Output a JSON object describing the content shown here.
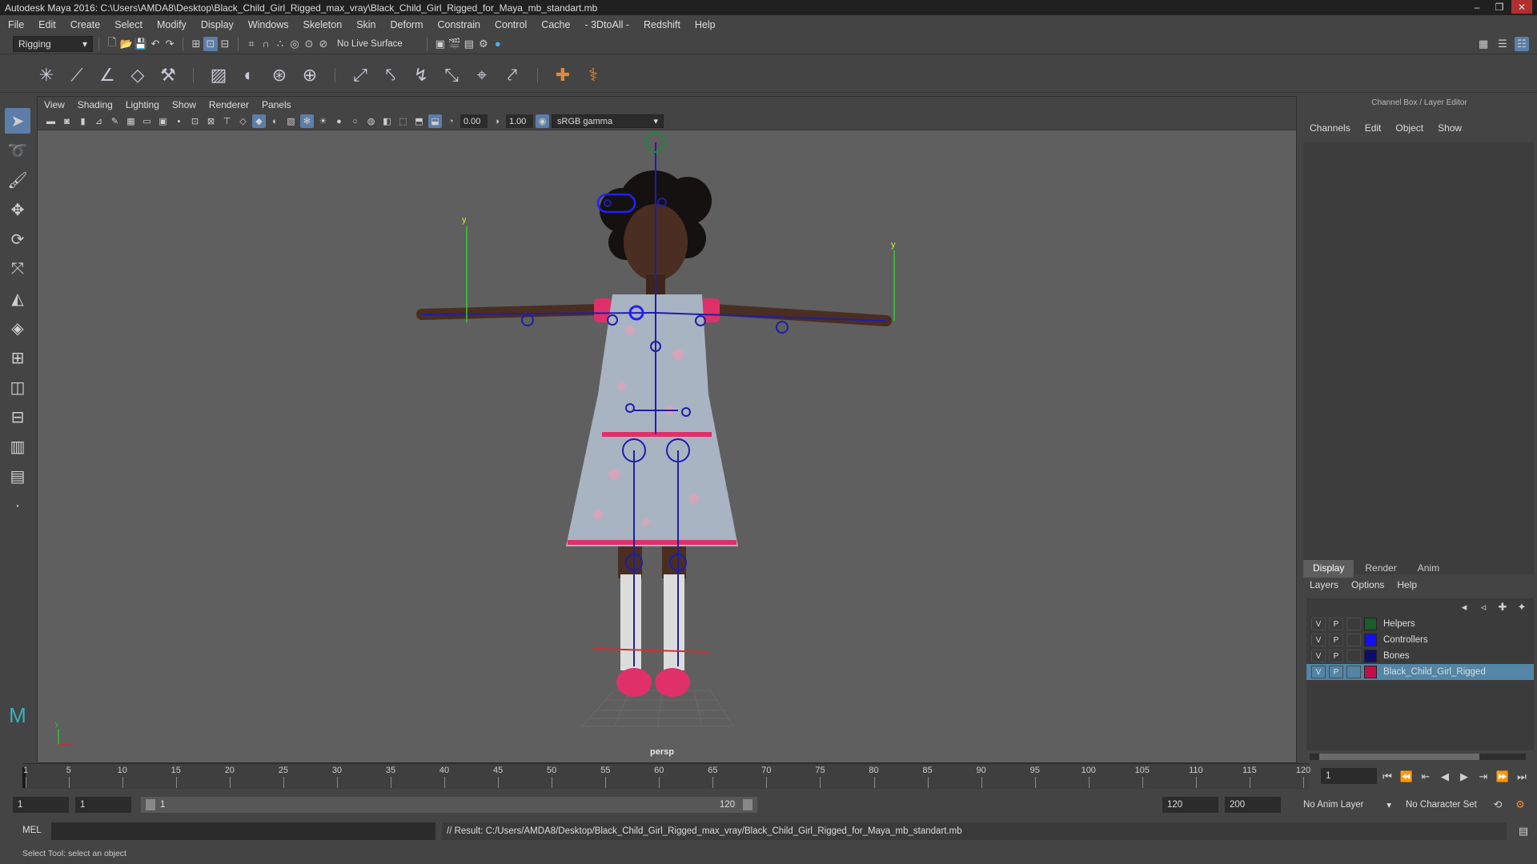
{
  "window": {
    "title": "Autodesk Maya 2016: C:\\Users\\AMDA8\\Desktop\\Black_Child_Girl_Rigged_max_vray\\Black_Child_Girl_Rigged_for_Maya_mb_standart.mb",
    "min": "–",
    "max": "❐",
    "close": "✕"
  },
  "menus": [
    "File",
    "Edit",
    "Create",
    "Select",
    "Modify",
    "Display",
    "Windows",
    "Skeleton",
    "Skin",
    "Deform",
    "Constrain",
    "Control",
    "Cache",
    "- 3DtoAll -",
    "Redshift",
    "Help"
  ],
  "status": {
    "menuset": "Rigging",
    "live_surface": "No Live Surface"
  },
  "panel": {
    "menus": [
      "View",
      "Shading",
      "Lighting",
      "Show",
      "Renderer",
      "Panels"
    ],
    "exposure": "0.00",
    "gamma": "1.00",
    "colorspace": "sRGB gamma",
    "camera": "persp"
  },
  "channelbox": {
    "title": "Channel Box / Layer Editor",
    "menus": [
      "Channels",
      "Edit",
      "Object",
      "Show"
    ]
  },
  "layers": {
    "tabs": [
      "Display",
      "Render",
      "Anim"
    ],
    "menus": [
      "Layers",
      "Options",
      "Help"
    ],
    "items": [
      {
        "v": "V",
        "p": "P",
        "name": "Helpers",
        "color": "#1a5c2a"
      },
      {
        "v": "V",
        "p": "P",
        "name": "Controllers",
        "color": "#1010f0"
      },
      {
        "v": "V",
        "p": "P",
        "name": "Bones",
        "color": "#0d0d6e"
      },
      {
        "v": "V",
        "p": "P",
        "name": "Black_Child_Girl_Rigged",
        "color": "#c0104a"
      }
    ]
  },
  "timeline": {
    "ticks": [
      1,
      5,
      10,
      15,
      20,
      25,
      30,
      35,
      40,
      45,
      50,
      55,
      60,
      65,
      70,
      75,
      80,
      85,
      90,
      95,
      100,
      105,
      110,
      115,
      120
    ],
    "current_frame": "1"
  },
  "range": {
    "start": "1",
    "playback_start": "1",
    "slider_start": "1",
    "slider_end": "120",
    "playback_end": "120",
    "end": "200",
    "anim_layer": "No Anim Layer",
    "character_set": "No Character Set"
  },
  "command": {
    "lang": "MEL",
    "result": "// Result: C:/Users/AMDA8/Desktop/Black_Child_Girl_Rigged_max_vray/Black_Child_Girl_Rigged_for_Maya_mb_standart.mb"
  },
  "help": "Select Tool: select an object",
  "colors": {
    "selection": "#5285a6",
    "joint": "#1e1ea8",
    "skin": "#4a2e22",
    "accent": "#e0306a"
  }
}
